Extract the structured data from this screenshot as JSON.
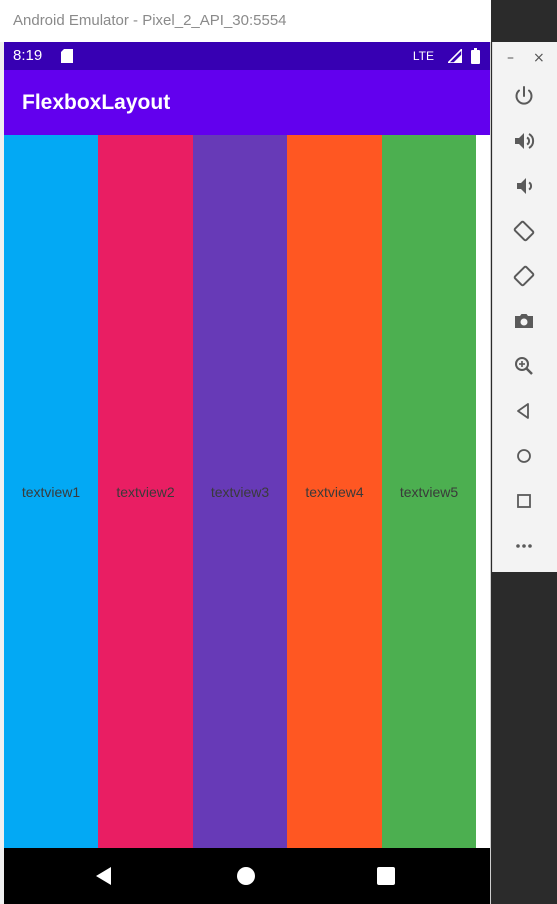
{
  "window": {
    "title": "Android Emulator - Pixel_2_API_30:5554"
  },
  "status_bar": {
    "time": "8:19",
    "network": "LTE"
  },
  "app_bar": {
    "title": "FlexboxLayout"
  },
  "flex_items": [
    {
      "label": "textview1",
      "color": "#03a9f4"
    },
    {
      "label": "textview2",
      "color": "#e91e63"
    },
    {
      "label": "textview3",
      "color": "#673ab7"
    },
    {
      "label": "textview4",
      "color": "#ff5722"
    },
    {
      "label": "textview5",
      "color": "#4caf50"
    }
  ],
  "colors": {
    "status_bar": "#3700b3",
    "app_bar": "#6200ee",
    "nav_bar": "#000000"
  },
  "toolbar": {
    "minimize": "–",
    "close": "×",
    "icons": [
      "power-icon",
      "volume-up-icon",
      "volume-down-icon",
      "rotate-left-icon",
      "rotate-right-icon",
      "camera-icon",
      "zoom-icon",
      "back-icon",
      "home-icon",
      "overview-icon",
      "more-icon"
    ]
  }
}
